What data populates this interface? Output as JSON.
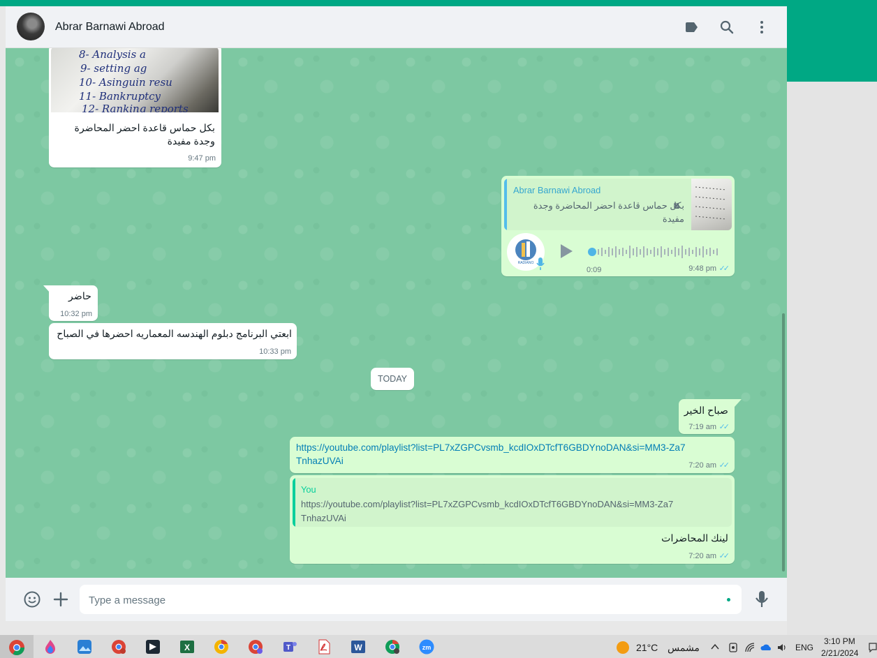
{
  "header": {
    "contact_name": "Abrar Barnawi Abroad"
  },
  "messages": {
    "m1": {
      "caption": "بكل حماس قاعدة احضر المحاضرة وجدة مفيدة",
      "time": "9:47 pm",
      "handwriting": [
        "8- Analysis a",
        "9- setting ag",
        "10- Asinguin resu",
        "11- Bankruptcy",
        "12- Ranking reports"
      ]
    },
    "m2": {
      "quoted_author": "Abrar Barnawi Abroad",
      "quoted_text": "بكل حماس قاعدة احضر المحاضرة وجدة مفيدة",
      "duration": "0:09",
      "time": "9:48 pm"
    },
    "m3": {
      "text": "حاضر",
      "time": "10:32 pm"
    },
    "m4": {
      "text": "ابعتي البرنامج دبلوم الهندسه المعماريه احضرها في الصباح",
      "time": "10:33 pm"
    },
    "date_divider": "TODAY",
    "m5": {
      "text": "صباح الخير",
      "time": "7:19 am"
    },
    "m6": {
      "text": "https://youtube.com/playlist?list=PL7xZGPCvsmb_kcdIOxDTcfT6GBDYnoDAN&si=MM3-Za7TnhazUVAi",
      "time": "7:20 am"
    },
    "m7": {
      "quoted_author": "You",
      "quoted_text": "https://youtube.com/playlist?list=PL7xZGPCvsmb_kcdIOxDTcfT6GBDYnoDAN&si=MM3-Za7TnhazUVAi",
      "text": "لينك المحاضرات",
      "time": "7:20 am"
    }
  },
  "composer": {
    "placeholder": "Type a message"
  },
  "taskbar": {
    "weather_temp": "21°C",
    "weather_label": "مشمس",
    "language": "ENG",
    "time": "3:10 PM",
    "date": "2/21/2024",
    "apps": [
      "chrome",
      "app-flame",
      "photos",
      "chrome-w",
      "capcut",
      "excel",
      "chrome",
      "chrome-w",
      "teams",
      "acrobat",
      "word",
      "chrome-profile",
      "zoom"
    ]
  },
  "colors": {
    "accent": "#00a884",
    "chat_bg": "#7dc8a2",
    "outgoing": "#d9fdd3",
    "read_ticks": "#53bdeb",
    "link": "#027eb5"
  }
}
